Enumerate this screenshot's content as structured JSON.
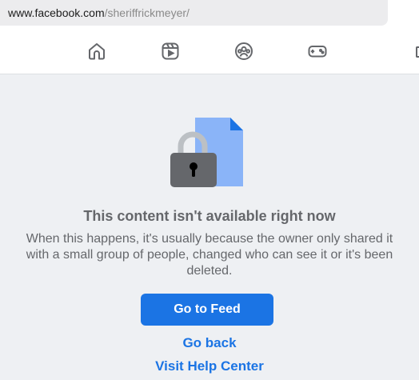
{
  "browser": {
    "url_domain": "www.facebook.com",
    "url_path": "/sheriffrickmeyer/"
  },
  "nav": {
    "icons": [
      "home-icon",
      "video-icon",
      "groups-icon",
      "gaming-icon"
    ]
  },
  "content": {
    "illustration": "locked-document-icon",
    "title": "This content isn't available right now",
    "message": "When this happens, it's usually because the owner only shared it with a small group of people, changed who can see it or it's been deleted.",
    "primary_button": "Go to Feed",
    "link_back": "Go back",
    "link_help": "Visit Help Center"
  },
  "colors": {
    "accent": "#1b74e4",
    "text_secondary": "#65676b",
    "background": "#eef0f3"
  }
}
